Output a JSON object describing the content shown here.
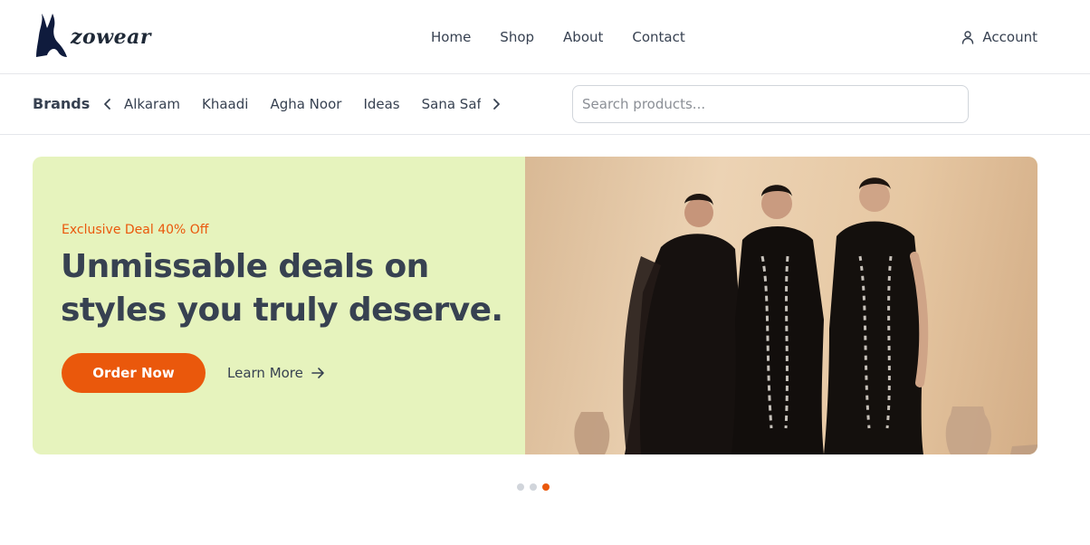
{
  "header": {
    "logo_text": "zowear",
    "nav": [
      "Home",
      "Shop",
      "About",
      "Contact"
    ],
    "account_label": "Account"
  },
  "brands": {
    "title": "Brands",
    "items": [
      "Alkaram",
      "Khaadi",
      "Agha Noor",
      "Ideas",
      "Sana Safinaz"
    ]
  },
  "search": {
    "placeholder": "Search products...",
    "value": ""
  },
  "hero": {
    "deal_text": "Exclusive Deal 40% Off",
    "headline": "Unmissable deals on styles you truly deserve.",
    "order_button": "Order Now",
    "learn_more": "Learn More",
    "slide_count": 3,
    "active_slide": 3
  },
  "colors": {
    "accent": "#ea580c",
    "hero_bg": "#e6f3bd",
    "text": "#374151",
    "logo": "#0f1b3d"
  },
  "icons": {
    "account": "user-icon",
    "prev": "chevron-left-icon",
    "next": "chevron-right-icon",
    "learn_more": "arrow-right-icon"
  }
}
